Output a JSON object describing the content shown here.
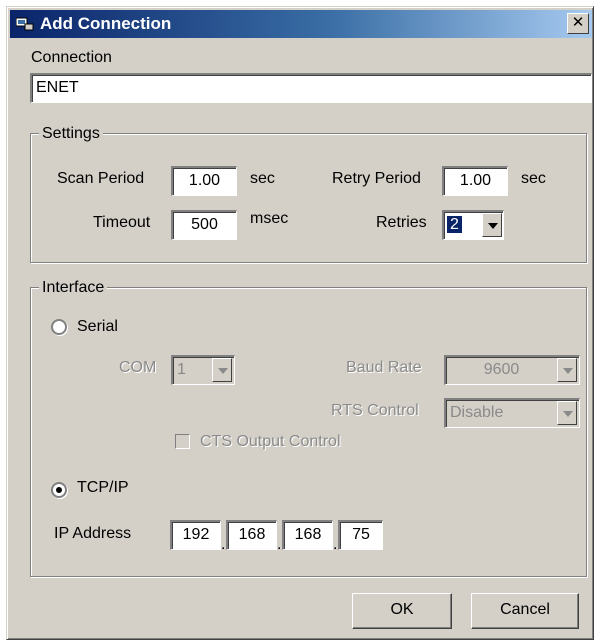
{
  "window": {
    "title": "Add Connection",
    "close_glyph": "✕",
    "icon": "network-app-icon"
  },
  "connection": {
    "label": "Connection",
    "value": "ENET"
  },
  "settings": {
    "group_label": "Settings",
    "scan_period": {
      "label": "Scan Period",
      "value": "1.00",
      "unit": "sec"
    },
    "retry_period": {
      "label": "Retry Period",
      "value": "1.00",
      "unit": "sec"
    },
    "timeout": {
      "label": "Timeout",
      "value": "500",
      "unit": "msec"
    },
    "retries": {
      "label": "Retries",
      "value": "2"
    }
  },
  "interface": {
    "group_label": "Interface",
    "selected": "TCP/IP",
    "serial": {
      "label": "Serial",
      "com": {
        "label": "COM",
        "value": "1"
      },
      "baud_rate": {
        "label": "Baud Rate",
        "value": "9600"
      },
      "rts_control": {
        "label": "RTS Control",
        "value": "Disable"
      },
      "cts_output_control": {
        "label": "CTS Output Control",
        "checked": false
      }
    },
    "tcpip": {
      "label": "TCP/IP",
      "ip_address": {
        "label": "IP Address",
        "octets": [
          "192",
          "168",
          "168",
          "75"
        ]
      }
    }
  },
  "buttons": {
    "ok": "OK",
    "cancel": "Cancel"
  },
  "colors": {
    "face": "#d4d0c8",
    "title_start": "#0a246a",
    "title_end": "#a6caf0",
    "disabled_text": "#8a8a8a"
  }
}
